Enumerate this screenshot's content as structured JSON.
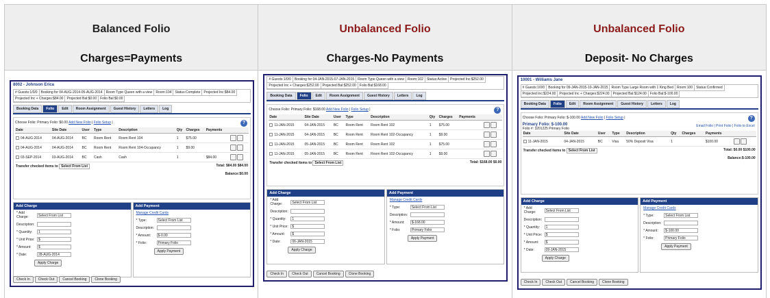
{
  "columns": [
    {
      "title": "Balanced Folio",
      "subtitle": "Charges=Payments",
      "title_color": "#111111",
      "shot": {
        "name": "8002 - Johnson Erica",
        "info": [
          "# Guests:1/0/0",
          "Booking for 04-AUG-2014-05-AUG-2014",
          "Room Type Queen with a view",
          "Room:104",
          "Status:Complete",
          "Projected Inc:$84.00",
          "Projected Inc + Charges:$84.00",
          "Projected Bal:$0.00",
          "Folio Bal:$0.00"
        ],
        "tabs": [
          "Booking Data",
          "Folio",
          "Edit",
          "Room Assignment",
          "Guest History",
          "Letters",
          "Log"
        ],
        "chooser": "Choose Folio: Primary Folio: $0.00",
        "links": [
          "Add New Folio",
          "Folio Setup"
        ],
        "headers": [
          "Date",
          "Site Date",
          "User",
          "Type",
          "Description",
          "Qty",
          "Charges",
          "Payments"
        ],
        "rows": [
          [
            "04-AUG-2014",
            "04-AUG-2014",
            "BC",
            "Room Rent",
            "Room Rent 104",
            "1",
            "$75.00",
            ""
          ],
          [
            "04-AUG-2014",
            "04-AUG-2014",
            "BC",
            "Room Rent",
            "Room Rent 104-Occupancy",
            "1",
            "$9.00",
            ""
          ],
          [
            "03-SEP-2014",
            "03-AUG-2014",
            "BC",
            "Cash",
            "Cash",
            "1",
            "",
            "$84.00"
          ]
        ],
        "transfer": "Transfer checked items to",
        "select": "Select From List",
        "total": "Total:",
        "total_charges": "$84.00",
        "total_payments": "$84.00",
        "balance": "Balance:",
        "balance_value": "$0.00",
        "charge_title": "Add Charge",
        "payment_title": "Add Payment",
        "charge_fields": [
          "* Add Charge:",
          "Description:",
          "* Quantity:",
          "* Unit Price:",
          "* Amount:",
          "* Date:"
        ],
        "charge_values": [
          "Select From List",
          "",
          "1",
          "$",
          "$",
          "28-AUG-2014"
        ],
        "payment_link": "Manage Credit Cards",
        "payment_fields": [
          "* Type:",
          "Description:",
          "* Amount:",
          "* Folio:"
        ],
        "payment_values": [
          "Select From List",
          "",
          "$-0.00",
          "Primary Folio"
        ],
        "apply_charge": "Apply Charge",
        "apply_payment": "Apply Payment",
        "bottom_buttons": [
          "Check In",
          "Check Out",
          "Cancel Booking",
          "Clone Booking"
        ]
      }
    },
    {
      "title": "Unbalanced Folio",
      "subtitle": "Charges-No Payments",
      "title_color": "#8b1a1a",
      "shot": {
        "name": "",
        "info": [
          "# Guests:1/0/0",
          "Booking for 04-JAN-2015-07-JAN-2015",
          "Room Type Queen with a view",
          "Room:102",
          "Status:Active",
          "Projected Inc:$252.00",
          "Projected Inc + Charges:$252.00",
          "Projected Bal:$252.00",
          "Folio Bal:$168.00"
        ],
        "tabs": [
          "Booking Data",
          "Folio",
          "Edit",
          "Room Assignment",
          "Guest History",
          "Letters",
          "Log"
        ],
        "chooser": "Choose Folio: Primary Folio: $168.00",
        "links": [
          "Add New Folio",
          "Folio Setup"
        ],
        "headers": [
          "Date",
          "Site Date",
          "User",
          "Type",
          "Description",
          "Qty",
          "Charges",
          "Payments"
        ],
        "rows": [
          [
            "11-JAN-2015",
            "04-JAN-2015",
            "BC",
            "Room Rent",
            "Room Rent 102",
            "1",
            "$75.00",
            ""
          ],
          [
            "11-JAN-2015",
            "04-JAN-2015",
            "BC",
            "Room Rent",
            "Room Rent 102-Occupancy",
            "1",
            "$9.00",
            ""
          ],
          [
            "11-JAN-2015",
            "05-JAN-2015",
            "BC",
            "Room Rent",
            "Room Rent 102",
            "1",
            "$75.00",
            ""
          ],
          [
            "11-JAN-2015",
            "05-JAN-2015",
            "BC",
            "Room Rent",
            "Room Rent 102-Occupancy",
            "1",
            "$9.00",
            ""
          ]
        ],
        "transfer": "Transfer checked items to",
        "select": "Select From List",
        "total": "Total:",
        "total_charges": "$168.00",
        "total_payments": "$0.00",
        "balance": "",
        "balance_value": "",
        "charge_title": "Add Charge",
        "payment_title": "Add Payment",
        "charge_fields": [
          "* Add Charge:",
          "Description:",
          "* Quantity:",
          "* Unit Price:",
          "* Amount:",
          "* Date:"
        ],
        "charge_values": [
          "Select From List",
          "",
          "1",
          "$",
          "$",
          "06-JAN-2015"
        ],
        "payment_link": "Manage Credit Cards",
        "payment_fields": [
          "* Type:",
          "Description:",
          "* Amount:",
          "* Folio:"
        ],
        "payment_values": [
          "Select From List",
          "",
          "$-168.00",
          "Primary Folio"
        ],
        "apply_charge": "Apply Charge",
        "apply_payment": "Apply Payment",
        "bottom_buttons": [
          "Check In",
          "Check Out",
          "Cancel Booking",
          "Clone Booking"
        ]
      }
    },
    {
      "title": "Unbalanced Folio",
      "subtitle": "Deposit- No Charges",
      "title_color": "#8b1a1a",
      "shot": {
        "name": "10001 - Williams Jane",
        "info": [
          "# Guests:1/0/0",
          "Booking for 09-JAN-2015-10-JAN-2015",
          "Room Type Large Room with 1 King Bed",
          "Room:100",
          "Status:Confirmed",
          "Projected Inc:$224.00",
          "Projected Inc + Charges:$224.00",
          "Projected Bal:$124.00",
          "Folio Bal:$-100.00"
        ],
        "tabs": [
          "Booking Data",
          "Folio",
          "Edit",
          "Room Assignment",
          "Guest History",
          "Letters",
          "Log"
        ],
        "chooser": "Choose Folio: Primary Folio: $-100.00",
        "links": [
          "Add New Folio",
          "Folio Setup"
        ],
        "folio_title": "Primary Folio: $-100.00",
        "folio_num": "Folio #: 3201225 Primary Folio",
        "folio_actions": "Email Folio | Print Folio | Folio to Excel",
        "headers": [
          "Date",
          "Site Date",
          "User",
          "Type",
          "Description",
          "Qty",
          "Charges",
          "Payments"
        ],
        "rows": [
          [
            "11-JAN-2015",
            "04-JAN-2015",
            "BC",
            "Visa",
            "50% Deposit Visa",
            "1",
            "",
            "$100.00"
          ]
        ],
        "transfer": "Transfer checked items to",
        "select": "Select From List",
        "total": "Total:",
        "total_charges": "$0.00",
        "total_payments": "$100.00",
        "balance": "Balance:",
        "balance_value": "$-100.00",
        "charge_title": "Add Charge",
        "payment_title": "Add Payment",
        "charge_fields": [
          "* Add Charge:",
          "Description:",
          "* Quantity:",
          "* Unit Price:",
          "* Amount:",
          "* Date:"
        ],
        "charge_values": [
          "Select From List",
          "",
          "1",
          "$",
          "$",
          "09-JAN-2015"
        ],
        "payment_link": "Manage Credit Cards",
        "payment_fields": [
          "* Type:",
          "Description:",
          "* Amount:",
          "* Folio:"
        ],
        "payment_values": [
          "Select From List",
          "",
          "$-100.00",
          "Primary Folio"
        ],
        "apply_charge": "Apply Charge",
        "apply_payment": "Apply Payment",
        "bottom_buttons": [
          "Check In",
          "Check Out",
          "Cancel Booking",
          "Clone Booking"
        ]
      }
    }
  ]
}
